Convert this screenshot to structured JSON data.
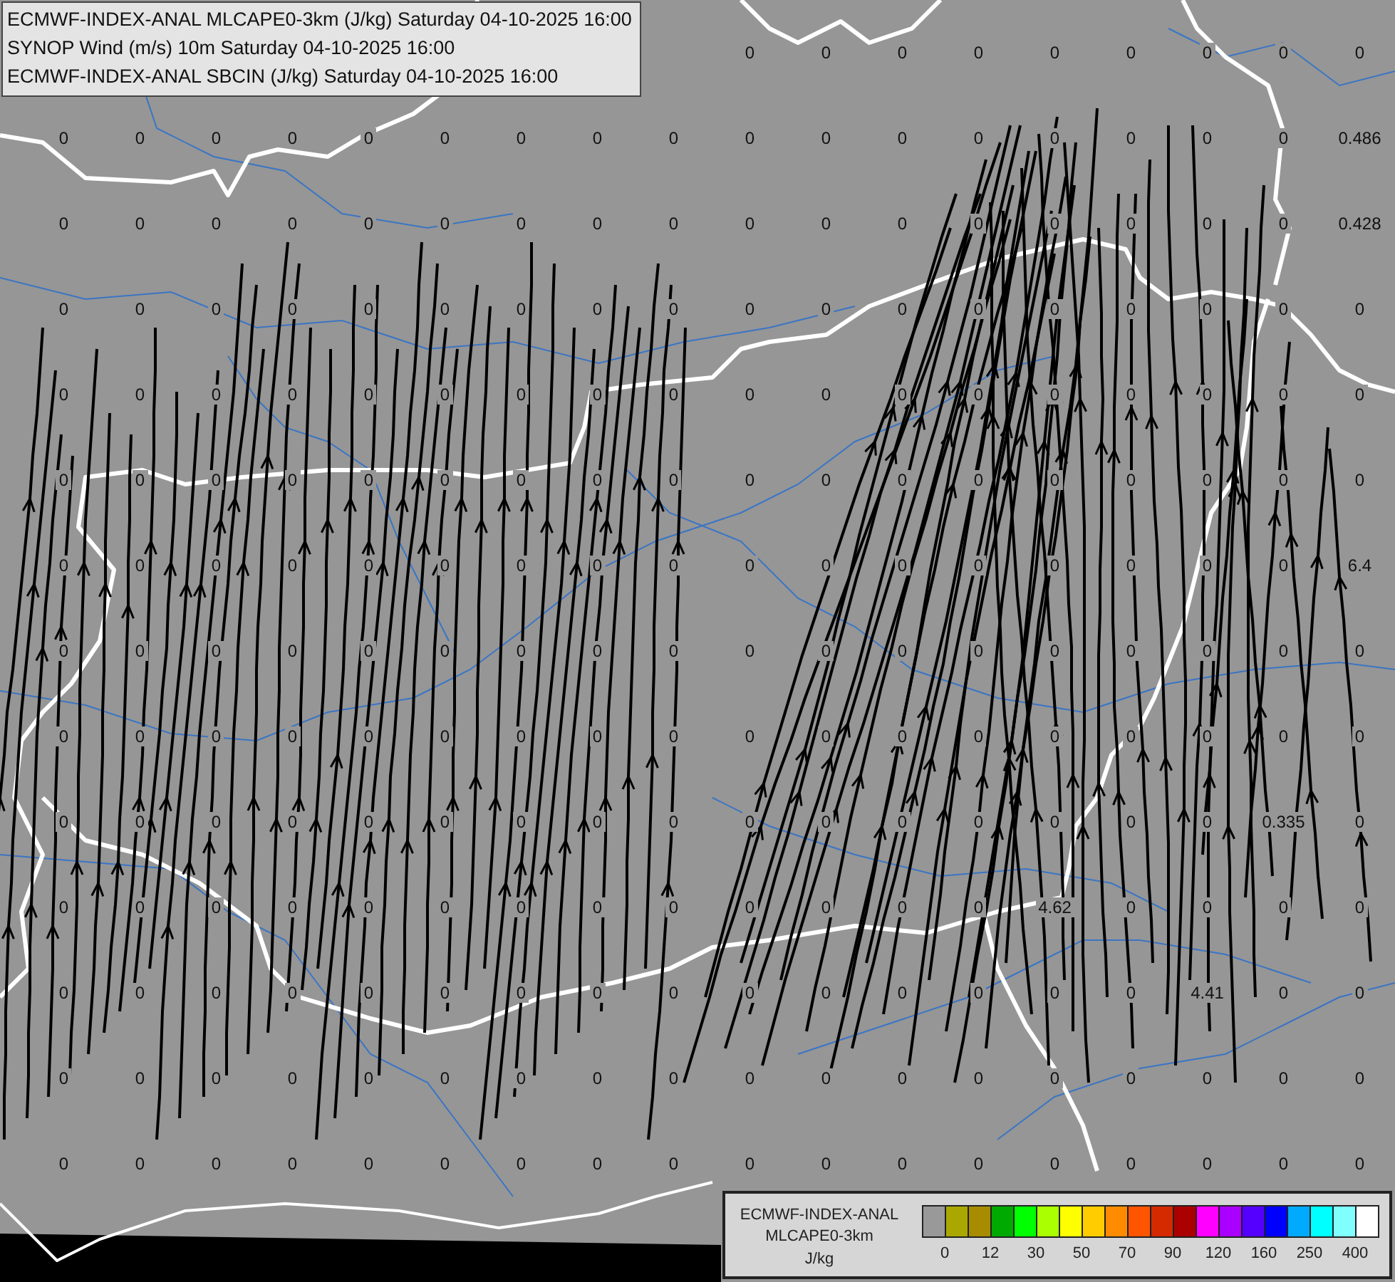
{
  "title_box": {
    "lines": [
      "ECMWF-INDEX-ANAL MLCAPE0-3km (J/kg) Saturday 04-10-2025 16:00",
      "SYNOP Wind (m/s) 10m Saturday 04-10-2025 16:00",
      "ECMWF-INDEX-ANAL SBCIN (J/kg) Saturday 04-10-2025 16:00"
    ]
  },
  "map": {
    "value_rows": [
      [
        null,
        null,
        null,
        null,
        null,
        null,
        null,
        null,
        null,
        "0",
        "0",
        "0",
        "0",
        "0",
        "0",
        "0",
        "0",
        "0"
      ],
      [
        "0",
        "0",
        "0",
        "0",
        "0",
        "0",
        "0",
        "0",
        "0",
        "0",
        "0",
        "0",
        "0",
        "0",
        "0",
        "0",
        "0",
        "0.486"
      ],
      [
        "0",
        "0",
        "0",
        "0",
        "0",
        "0",
        "0",
        "0",
        "0",
        "0",
        "0",
        "0",
        "0",
        "0",
        "0",
        "0",
        "0",
        "0.428"
      ],
      [
        "0",
        "0",
        "0",
        "0",
        "0",
        "0",
        "0",
        "0",
        "0",
        "0",
        "0",
        "0",
        "0",
        "0",
        "0",
        "0",
        "0",
        "0"
      ],
      [
        "0",
        "0",
        "0",
        "0",
        "0",
        "0",
        "0",
        "0",
        "0",
        "0",
        "0",
        "0",
        "0",
        "0",
        "0",
        "0",
        "0",
        "0"
      ],
      [
        "0",
        "0",
        "0",
        "0",
        "0",
        "0",
        "0",
        "0",
        "0",
        "0",
        "0",
        "0",
        "0",
        "0",
        "0",
        "0",
        "0",
        "0"
      ],
      [
        "0",
        "0",
        "0",
        "0",
        "0",
        "0",
        "0",
        "0",
        "0",
        "0",
        "0",
        "0",
        "0",
        "0",
        "0",
        "0",
        "0",
        "6.4"
      ],
      [
        "0",
        "0",
        "0",
        "0",
        "0",
        "0",
        "0",
        "0",
        "0",
        "0",
        "0",
        "0",
        "0",
        "0",
        "0",
        "0",
        "0",
        "0"
      ],
      [
        "0",
        "0",
        "0",
        "0",
        "0",
        "0",
        "0",
        "0",
        "0",
        "0",
        "0",
        "0",
        "0",
        "0",
        "0",
        "0",
        "0",
        "0"
      ],
      [
        "0",
        "0",
        "0",
        "0",
        "0",
        "0",
        "0",
        "0",
        "0",
        "0",
        "0",
        "0",
        "0",
        "0",
        "0",
        "0",
        "0.335",
        "0"
      ],
      [
        "0",
        "0",
        "0",
        "0",
        "0",
        "0",
        "0",
        "0",
        "0",
        "0",
        "0",
        "0",
        "0",
        "4.62",
        "0",
        "0",
        "0",
        "0"
      ],
      [
        "0",
        "0",
        "0",
        "0",
        "0",
        "0",
        "0",
        "0",
        "0",
        "0",
        "0",
        "0",
        "0",
        "0",
        "0",
        "4.41",
        "0",
        "0"
      ],
      [
        "0",
        "0",
        "0",
        "0",
        "0",
        "0",
        "0",
        "0",
        "0",
        "0",
        "0",
        "0",
        "0",
        "0",
        "0",
        "0",
        "0",
        "0"
      ],
      [
        "0",
        "0",
        "0",
        "0",
        "0",
        "0",
        "0",
        "0",
        "0",
        "0",
        "0",
        "0",
        "0",
        "0",
        "0",
        "0",
        "0",
        "0"
      ]
    ]
  },
  "legend": {
    "title_lines": [
      "ECMWF-INDEX-ANAL",
      "MLCAPE0-3km"
    ],
    "unit": "J/kg",
    "swatches": [
      {
        "color": "#999999"
      },
      {
        "color": "#aaa800"
      },
      {
        "color": "#a88c00"
      },
      {
        "color": "#00aa00"
      },
      {
        "color": "#00ff00"
      },
      {
        "color": "#aaff00"
      },
      {
        "color": "#ffff00"
      },
      {
        "color": "#ffcc00"
      },
      {
        "color": "#ff8c00"
      },
      {
        "color": "#ff5500"
      },
      {
        "color": "#d42a00"
      },
      {
        "color": "#aa0000"
      },
      {
        "color": "#ff00ff"
      },
      {
        "color": "#aa00ff"
      },
      {
        "color": "#5500ff"
      },
      {
        "color": "#0000ff"
      },
      {
        "color": "#00aaff"
      },
      {
        "color": "#00ffff"
      },
      {
        "color": "#80ffff"
      },
      {
        "color": "#ffffff"
      }
    ],
    "tick_labels": [
      "0",
      "12",
      "30",
      "50",
      "70",
      "90",
      "120",
      "160",
      "250",
      "400"
    ]
  }
}
